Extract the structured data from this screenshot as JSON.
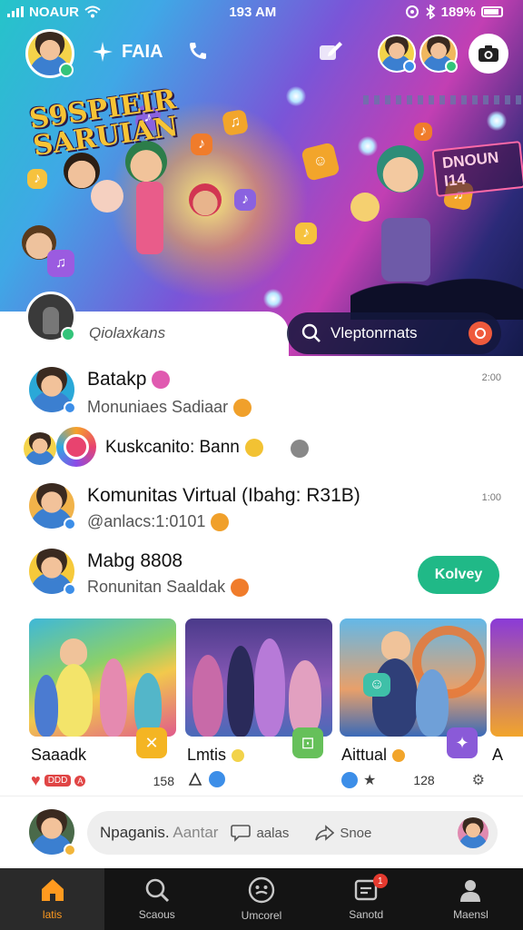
{
  "status_bar": {
    "carrier": "NOAUR",
    "time": "193 AM",
    "battery": "189%"
  },
  "header": {
    "app_name": "FAIA"
  },
  "hero": {
    "logo_lines": [
      "S9SPIEIR",
      "SARUIAN"
    ],
    "stage_sign": "DNOUN I14"
  },
  "search": {
    "left_label": "Qiolaxkans",
    "right_label": "Vleptonrnats"
  },
  "feed": [
    {
      "title": "Batakp",
      "subtitle": "Monuniaes Sadiaar",
      "meta": "2:00"
    },
    {
      "title": "Kuskcanito: Bann",
      "subtitle": "",
      "meta": ""
    },
    {
      "title": "Komunitas Virtual (Ibahg: R31B)",
      "subtitle": "@anlacs:1:0101",
      "meta": "1:00"
    },
    {
      "title": "Mabg 8808",
      "subtitle": "Ronunitan Saaldak",
      "button": "Kolvey"
    }
  ],
  "cards": [
    {
      "name": "Saaadk",
      "count": "158",
      "sticker": "✕"
    },
    {
      "name": "Lmtis",
      "count": "",
      "sticker": "⊡"
    },
    {
      "name": "Aittual",
      "count": "128",
      "sticker": "✦"
    },
    {
      "name": "A",
      "count": "",
      "sticker": ""
    }
  ],
  "card_badges": [
    "DDD",
    "A"
  ],
  "composer": {
    "placeholder_main": "Npaganis.",
    "placeholder_faded": "Aantar",
    "comment_label": "aalas",
    "share_label": "Snoe"
  },
  "bottom_nav": [
    {
      "label": "latis",
      "icon": "home-icon",
      "active": true
    },
    {
      "label": "Scaous",
      "icon": "search-icon",
      "active": false
    },
    {
      "label": "Umcorel",
      "icon": "smiley-icon",
      "active": false
    },
    {
      "label": "Sanotd",
      "icon": "inbox-icon",
      "active": false,
      "badge": "1"
    },
    {
      "label": "Maensl",
      "icon": "profile-icon",
      "active": false
    }
  ],
  "colors": {
    "accent": "#ff9a1f",
    "follow_button": "#20b987",
    "nav_background": "#141414"
  }
}
